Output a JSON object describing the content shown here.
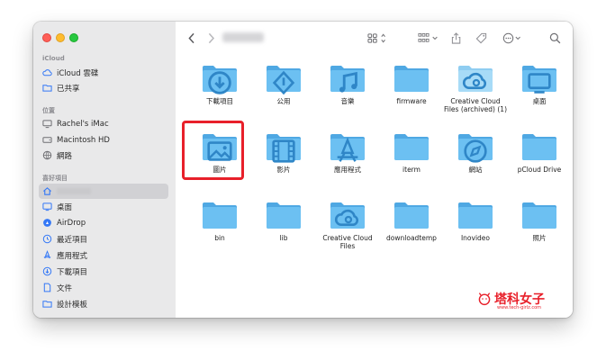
{
  "sidebar": {
    "sections": [
      {
        "title": "iCloud",
        "items": [
          {
            "label": "iCloud 雲碟",
            "icon": "cloud-icon"
          },
          {
            "label": "已共享",
            "icon": "shared-folder-icon"
          }
        ]
      },
      {
        "title": "位置",
        "items": [
          {
            "label": "Rachel's iMac",
            "icon": "computer-icon"
          },
          {
            "label": "Macintosh HD",
            "icon": "disk-icon"
          },
          {
            "label": "網路",
            "icon": "network-icon"
          }
        ]
      },
      {
        "title": "喜好項目",
        "items": [
          {
            "label": "",
            "icon": "home-icon",
            "selected": true
          },
          {
            "label": "桌面",
            "icon": "desktop-icon"
          },
          {
            "label": "AirDrop",
            "icon": "airdrop-icon"
          },
          {
            "label": "最近項目",
            "icon": "clock-icon"
          },
          {
            "label": "應用程式",
            "icon": "applications-icon"
          },
          {
            "label": "下載項目",
            "icon": "download-icon"
          },
          {
            "label": "文件",
            "icon": "document-icon"
          },
          {
            "label": "設計模板",
            "icon": "folder-icon"
          }
        ]
      }
    ]
  },
  "folders": [
    {
      "label": "下載項目",
      "emblem": "download",
      "light": false
    },
    {
      "label": "公用",
      "emblem": "public",
      "light": false
    },
    {
      "label": "音樂",
      "emblem": "music",
      "light": false
    },
    {
      "label": "firmware",
      "emblem": "",
      "light": false
    },
    {
      "label": "Creative Cloud Files (archived) (1)",
      "emblem": "creative-cloud",
      "light": true
    },
    {
      "label": "桌面",
      "emblem": "desktop",
      "light": false
    },
    {
      "label": "圖片",
      "emblem": "pictures",
      "light": false
    },
    {
      "label": "影片",
      "emblem": "movies",
      "light": false
    },
    {
      "label": "應用程式",
      "emblem": "applications",
      "light": false
    },
    {
      "label": "iterm",
      "emblem": "",
      "light": false
    },
    {
      "label": "網站",
      "emblem": "sites",
      "light": false
    },
    {
      "label": "pCloud Drive",
      "emblem": "",
      "light": false
    },
    {
      "label": "bin",
      "emblem": "",
      "light": false
    },
    {
      "label": "lib",
      "emblem": "",
      "light": false
    },
    {
      "label": "Creative Cloud Files",
      "emblem": "creative-cloud",
      "light": false
    },
    {
      "label": "downloadtemp",
      "emblem": "",
      "light": false
    },
    {
      "label": "Inovideo",
      "emblem": "",
      "light": false
    },
    {
      "label": "照片",
      "emblem": "",
      "light": false
    }
  ],
  "highlighted_folder": "圖片",
  "colors": {
    "folder": "#5cb6ee",
    "folder_light": "#9fd6f5",
    "highlight": "#e8202a"
  },
  "watermark": {
    "text": "塔科女子",
    "sub": "www.tech-girlz.com"
  }
}
